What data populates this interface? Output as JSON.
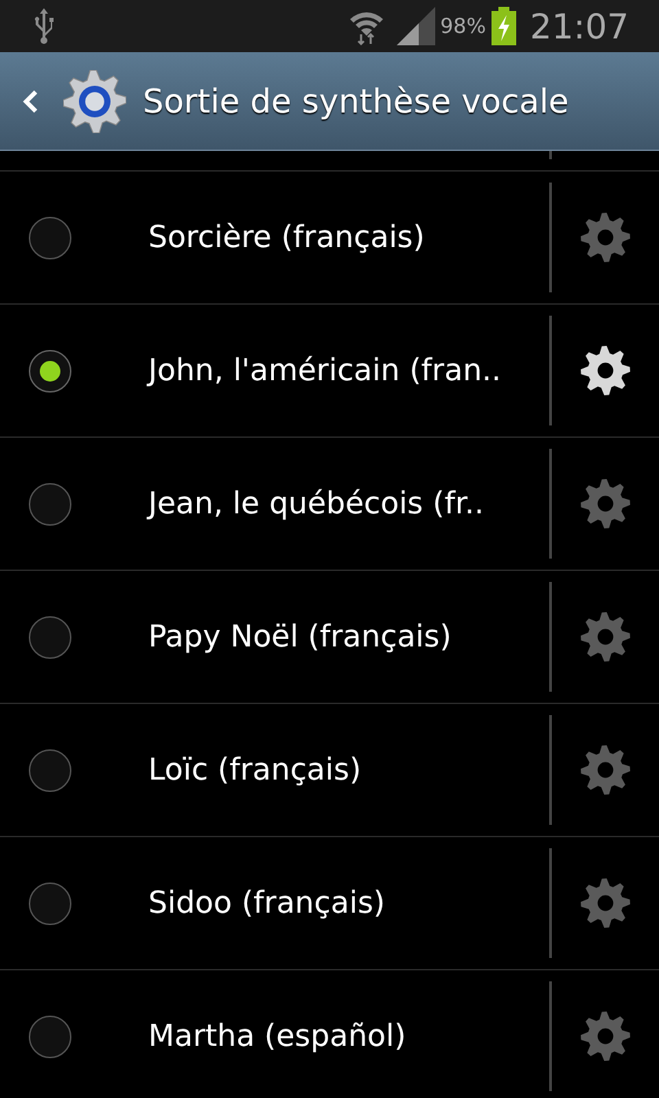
{
  "status_bar": {
    "battery": "98%",
    "time": "21:07"
  },
  "header": {
    "title": "Sortie de synthèse vocale"
  },
  "voices": [
    {
      "name": "Sorcière (français)",
      "selected": false,
      "settings_enabled": false
    },
    {
      "name": "John, l'américain (fran..",
      "selected": true,
      "settings_enabled": true
    },
    {
      "name": "Jean, le québécois (fr..",
      "selected": false,
      "settings_enabled": false
    },
    {
      "name": "Papy Noël (français)",
      "selected": false,
      "settings_enabled": false
    },
    {
      "name": "Loïc (français)",
      "selected": false,
      "settings_enabled": false
    },
    {
      "name": "Sidoo (français)",
      "selected": false,
      "settings_enabled": false
    },
    {
      "name": "Martha (español)",
      "selected": false,
      "settings_enabled": false
    }
  ]
}
